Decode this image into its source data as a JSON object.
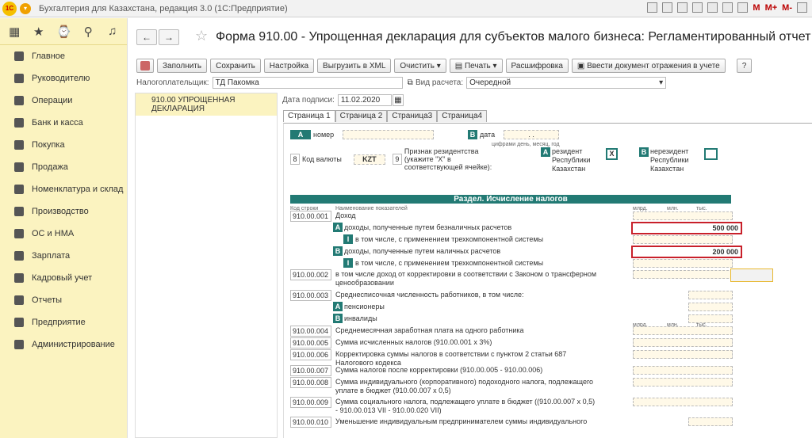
{
  "window": {
    "title": "Бухгалтерия для Казахстана, редакция 3.0  (1С:Предприятие)",
    "logo": "1С",
    "m1": "M",
    "m2": "M+",
    "m3": "M-"
  },
  "sidebar": {
    "items": [
      "Главное",
      "Руководителю",
      "Операции",
      "Банк и касса",
      "Покупка",
      "Продажа",
      "Номенклатура и склад",
      "Производство",
      "ОС и НМА",
      "Зарплата",
      "Кадровый учет",
      "Отчеты",
      "Предприятие",
      "Администрирование"
    ]
  },
  "form": {
    "title": "Форма 910.00 - Упрощенная декларация для субъектов малого бизнеса: Регламентированный отчет 910 фо",
    "toolbar": {
      "fill": "Заполнить",
      "save": "Сохранить",
      "settings": "Настройка",
      "xml": "Выгрузить в XML",
      "clear": "Очистить",
      "print": "Печать",
      "decode": "Расшифровка",
      "enter_doc": "Ввести документ отражения в учете",
      "help": "?"
    },
    "taxpayer_label": "Налогоплательщик:",
    "taxpayer": "ТД Пакомка",
    "calc_label": "Вид расчета:",
    "calc": "Очередной",
    "date_label": "Дата подписи:",
    "date": "11.02.2020",
    "list_item": "910.00 УПРОЩЕННАЯ ДЕКЛАРАЦИЯ"
  },
  "tabs": [
    "Страница 1",
    "Страница 2",
    "Страница3",
    "Страница4"
  ],
  "page": {
    "nomer": "номер",
    "data": "дата",
    "date_hint": "цифрами день, месяц, год",
    "dots": ". .",
    "code8": "8",
    "currency_label": "Код валюты",
    "kzt": "KZT",
    "code9": "9",
    "resident_label": "Признак резидентства (укажите \"X\" в соответствующей ячейке):",
    "resident": "резидент Республики Казахстан",
    "x": "X",
    "nonresident": "нерезидент Республики Казахстан",
    "section": "Раздел. Исчисление налогов",
    "col_code": "Код строки",
    "col_name": "Наименование показателей",
    "mlrd": "млрд.",
    "mln": "млн.",
    "tys": "тыс.",
    "rows": [
      {
        "code": "910.00.001",
        "text": "Доход"
      },
      {
        "letter": "A",
        "text": "доходы, полученные путем безналичных расчетов",
        "value": "500 000"
      },
      {
        "letter": "I",
        "text": "в том числе, с применением трехкомпонентной системы"
      },
      {
        "letter": "B",
        "text": "доходы, полученные путем наличных расчетов",
        "value": "200 000"
      },
      {
        "letter": "I",
        "text": "в том числе, с применением трехкомпонентной системы"
      },
      {
        "code": "910.00.002",
        "text": "в том числе доход от корректировки в соответствии с Законом о трансферном ценообразовании"
      },
      {
        "code": "910.00.003",
        "text": "Среднесписочная численность работников, в том числе:"
      },
      {
        "letter": "A",
        "text": "пенсионеры"
      },
      {
        "letter": "B",
        "text": "инвалиды"
      },
      {
        "code": "910.00.004",
        "text": "Среднемесячная заработная плата на одного работника"
      },
      {
        "code": "910.00.005",
        "text": "Сумма исчисленных налогов (910.00.001 x 3%)"
      },
      {
        "code": "910.00.006",
        "text": "Корректировка суммы налогов в соответствии с пунктом 2 статьи 687 Налогового кодекса"
      },
      {
        "code": "910.00.007",
        "text": "Сумма налогов после корректировки (910.00.005 - 910.00.006)"
      },
      {
        "code": "910.00.008",
        "text": "Сумма индивидуального (корпоративного) подоходного налога, подлежащего уплате в бюджет (910.00.007 x 0,5)"
      },
      {
        "code": "910.00.009",
        "text": "Сумма социального налога, подлежащего уплате в бюджет ((910.00.007 x 0,5) - 910.00.013 VII - 910.00.020 VII)"
      },
      {
        "code": "910.00.010",
        "text": "Уменьшение индивидуальным предпринимателем суммы индивидуального"
      }
    ]
  }
}
